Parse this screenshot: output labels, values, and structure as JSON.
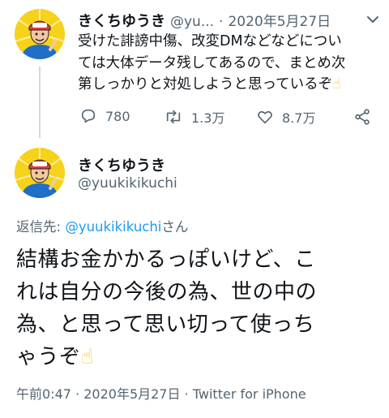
{
  "tweet1": {
    "display_name": "きくちゆうき",
    "handle": "@yu...",
    "separator": "·",
    "date": "2020年5月27日",
    "text_line1": "受けた誹謗中傷、改変DMなどなどについ",
    "text_line2": "ては大体データ残してあるので、まとめ次",
    "text_line3": "第しっかりと対処しようと思っているぞ",
    "emoji": "☝",
    "actions": {
      "replies": "780",
      "retweets": "1.3万",
      "likes": "8.7万"
    }
  },
  "tweet2": {
    "display_name": "きくちゆうき",
    "handle": "@yuukikikuchi",
    "reply_label": "返信先: ",
    "reply_handle": "@yuukikikuchi",
    "reply_suffix": "さん",
    "text_line1": "結構お金かかるっぽいけど、こ",
    "text_line2": "れは自分の今後の為、世の中の",
    "text_line3": "為、と思って思い切って使っち",
    "text_line4": "ゃうぞ",
    "emoji": "☝",
    "time": "午前0:47",
    "separator1": "·",
    "date": "2020年5月27日",
    "separator2": "·",
    "source": "Twitter for iPhone"
  },
  "colors": {
    "text": "#0f1419",
    "secondary": "#536471",
    "link": "#1d9bf0",
    "avatar_bg": "#f6d21a"
  },
  "icons": [
    "chevron-down-icon",
    "reply-icon",
    "retweet-icon",
    "like-icon",
    "share-icon"
  ]
}
